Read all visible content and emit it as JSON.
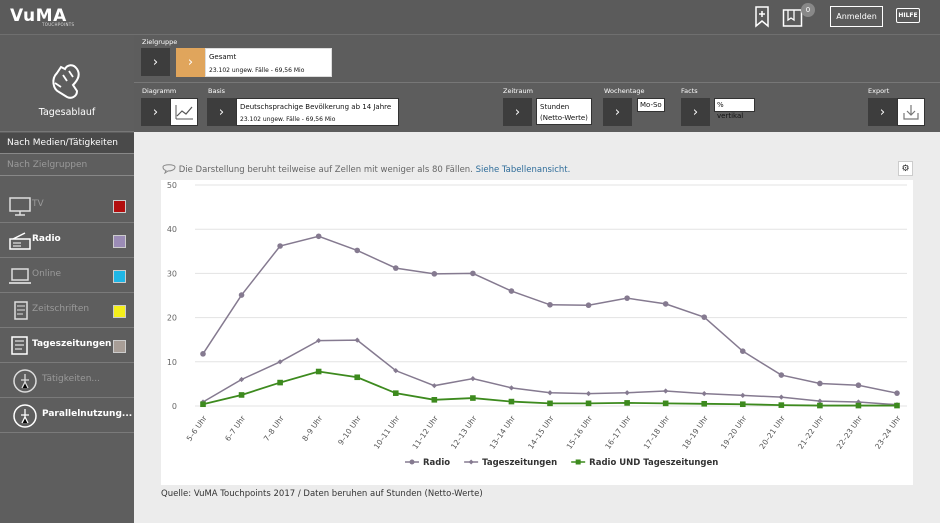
{
  "topbar": {
    "logo": "VuMA",
    "logo_sub": "TOUCHPOINTS",
    "notify_count": "0",
    "login": "Anmelden",
    "help": "HILFE"
  },
  "sidebar": {
    "header": "Tagesablauf",
    "links": [
      "Nach Medien/Tätigkeiten",
      "Nach Zielgruppen"
    ],
    "items": [
      {
        "label": "TV",
        "icon": "tv-icon",
        "color": "#b20e0e",
        "active": false
      },
      {
        "label": "Radio",
        "icon": "radio-icon",
        "color": "#9b8cb6",
        "active": true
      },
      {
        "label": "Online",
        "icon": "laptop-icon",
        "color": "#1fb6e6",
        "active": false
      },
      {
        "label": "Zeitschriften",
        "icon": "magazine-icon",
        "color": "#f5ef1b",
        "active": false
      },
      {
        "label": "Tageszeitungen",
        "icon": "newspaper-icon",
        "color": "#a89e97",
        "active": true
      },
      {
        "label": "Tätigkeiten...",
        "icon": "activity-icon",
        "active": false
      },
      {
        "label": "Parallelnutzung...",
        "icon": "parallel-icon",
        "active": true
      }
    ]
  },
  "filters": {
    "zielgruppe_label": "Zielgruppe",
    "zielgruppe_value": "Gesamt",
    "zielgruppe_sub": "23.102 ungew. Fälle - 69,56 Mio",
    "diagramm_label": "Diagramm",
    "basis_label": "Basis",
    "basis_value": "Deutschsprachige Bevölkerung ab 14 Jahre",
    "basis_sub": "23.102 ungew. Fälle - 69,56 Mio",
    "zeitraum_label": "Zeitraum",
    "zeitraum_value_1": "Stunden",
    "zeitraum_value_2": "(Netto-Werte)",
    "wochentage_label": "Wochentage",
    "wochentage_value": "Mo-So",
    "facts_label": "Facts",
    "facts_value": "% vertikal",
    "export_label": "Export"
  },
  "main": {
    "notice": "Die Darstellung beruht teilweise auf Zellen mit weniger als 80 Fällen.",
    "notice_link": "Siehe Tabellenansicht.",
    "source": "Quelle: VuMA Touchpoints 2017 / Daten beruhen auf Stunden (Netto-Werte)"
  },
  "chart_data": {
    "type": "line",
    "categories": [
      "5–6 Uhr",
      "6–7 Uhr",
      "7–8 Uhr",
      "8–9 Uhr",
      "9–10 Uhr",
      "10–11 Uhr",
      "11–12 Uhr",
      "12–13 Uhr",
      "13–14 Uhr",
      "14–15 Uhr",
      "15–16 Uhr",
      "16–17 Uhr",
      "17–18 Uhr",
      "18–19 Uhr",
      "19–20 Uhr",
      "20–21 Uhr",
      "21–22 Uhr",
      "22–23 Uhr",
      "23–24 Uhr"
    ],
    "yticks": [
      "0",
      "10",
      "20",
      "30",
      "40",
      "50"
    ],
    "ylim": [
      0,
      50
    ],
    "grid": true,
    "legend_position": "bottom",
    "series": [
      {
        "name": "Radio",
        "color": "#857a90",
        "marker": "circle",
        "values": [
          11.8,
          25.1,
          36.2,
          38.4,
          35.2,
          31.2,
          29.9,
          30.0,
          26.0,
          22.9,
          22.8,
          24.4,
          23.1,
          20.1,
          12.4,
          7.0,
          5.1,
          4.7,
          2.9
        ]
      },
      {
        "name": "Tageszeitungen",
        "color": "#857a90",
        "marker": "diamond",
        "values": [
          0.9,
          6.0,
          10.0,
          14.8,
          14.9,
          8.0,
          4.6,
          6.2,
          4.1,
          3.0,
          2.8,
          3.0,
          3.4,
          2.8,
          2.4,
          2.0,
          1.1,
          0.9,
          0.3
        ]
      },
      {
        "name": "Radio UND Tageszeitungen",
        "color": "#3d8a1e",
        "marker": "square",
        "values": [
          0.4,
          2.5,
          5.3,
          7.8,
          6.5,
          2.9,
          1.4,
          1.8,
          1.0,
          0.6,
          0.6,
          0.7,
          0.6,
          0.5,
          0.4,
          0.2,
          0.1,
          0.1,
          0.1
        ]
      }
    ]
  }
}
